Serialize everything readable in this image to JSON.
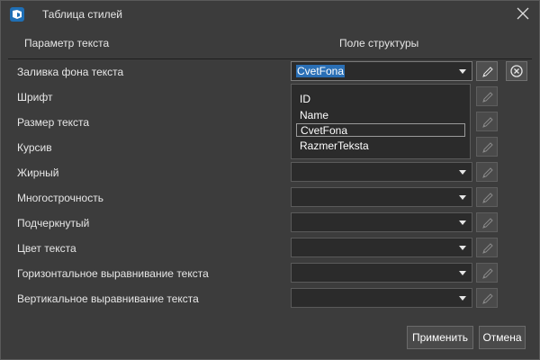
{
  "window": {
    "title": "Таблица стилей"
  },
  "headers": {
    "param": "Параметр текста",
    "field": "Поле структуры"
  },
  "rows": [
    {
      "label": "Заливка фона текста",
      "value": "CvetFona"
    },
    {
      "label": "Шрифт",
      "value": ""
    },
    {
      "label": "Размер текста",
      "value": ""
    },
    {
      "label": "Курсив",
      "value": ""
    },
    {
      "label": "Жирный",
      "value": ""
    },
    {
      "label": "Многострочность",
      "value": ""
    },
    {
      "label": "Подчеркнутый",
      "value": ""
    },
    {
      "label": "Цвет текста",
      "value": ""
    },
    {
      "label": "Горизонтальное выравнивание текста",
      "value": ""
    },
    {
      "label": "Вертикальное выравнивание текста",
      "value": ""
    }
  ],
  "dropdown": {
    "options": [
      "ID",
      "Name",
      "CvetFona",
      "RazmerTeksta"
    ],
    "selected": "CvetFona"
  },
  "buttons": {
    "apply": "Применить",
    "cancel": "Отмена"
  },
  "icons": {
    "app": "app-logo-icon",
    "close": "close-icon",
    "edit": "pencil-icon",
    "clear": "clear-circle-icon",
    "dropdown": "chevron-down-icon"
  },
  "colors": {
    "background": "#3c3c3c",
    "field": "#2b2b2b",
    "selection": "#2a6fb5"
  }
}
